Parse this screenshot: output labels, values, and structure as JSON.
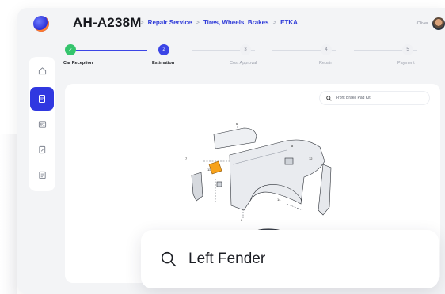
{
  "header": {
    "vehicle_id": "AH-A238M",
    "breadcrumbs": [
      "Repair Service",
      "Tires, Wheels, Brakes",
      "ETKA"
    ],
    "breadcrumb_separator": ">",
    "user_name": "Oliver"
  },
  "stepper": {
    "steps": [
      {
        "number": "✓",
        "label": "Car Reception",
        "state": "done"
      },
      {
        "number": "2",
        "label": "Estimation",
        "state": "active"
      },
      {
        "number": "3",
        "label": "Cost Approval",
        "state": "todo"
      },
      {
        "number": "4",
        "label": "Repair",
        "state": "todo"
      },
      {
        "number": "5",
        "label": "Payment",
        "state": "todo"
      }
    ]
  },
  "sidebar": {
    "items": [
      {
        "icon": "home-icon",
        "active": false
      },
      {
        "icon": "document-icon",
        "active": true
      },
      {
        "icon": "id-card-icon",
        "active": false
      },
      {
        "icon": "edit-document-icon",
        "active": false
      },
      {
        "icon": "notes-icon",
        "active": false
      }
    ]
  },
  "panel": {
    "search_value": "Front Brake Pad Kit",
    "diagram_icon": "fender-exploded-diagram"
  },
  "floating_search": {
    "value": "Left Fender"
  },
  "colors": {
    "accent": "#3038e0",
    "success": "#34c46c",
    "background": "#f3f4f6"
  }
}
